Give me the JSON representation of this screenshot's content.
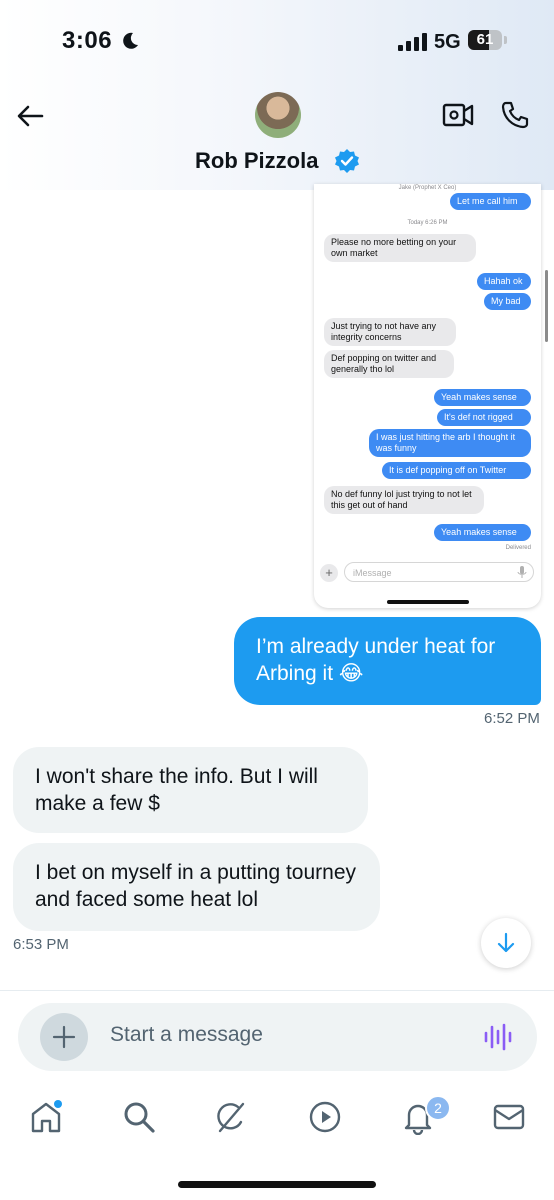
{
  "status_bar": {
    "time": "3:06",
    "network": "5G",
    "battery": "61",
    "battery_level": 0.61
  },
  "header": {
    "contact_name": "Rob Pizzola"
  },
  "embedded_screenshot": {
    "contact_label": "Jake (Prophet X Ceo)",
    "date_label": "Today 6:26 PM",
    "messages": [
      {
        "text": "Let me call him",
        "direction": "out"
      },
      {
        "text": "Please no more betting on your own market",
        "direction": "in"
      },
      {
        "text": "Hahah ok",
        "direction": "out"
      },
      {
        "text": "My bad",
        "direction": "out"
      },
      {
        "text": "Just trying to not have any integrity concerns",
        "direction": "in"
      },
      {
        "text": "Def popping on twitter and generally tho lol",
        "direction": "in"
      },
      {
        "text": "Yeah makes sense",
        "direction": "out"
      },
      {
        "text": "It's def not rigged",
        "direction": "out"
      },
      {
        "text": "I was just hitting the arb I thought it was funny",
        "direction": "out"
      },
      {
        "text": "It is def popping off on Twitter",
        "direction": "out"
      },
      {
        "text": "No def funny lol just trying to not let this get out of hand",
        "direction": "in"
      },
      {
        "text": "Yeah makes sense",
        "direction": "out"
      }
    ],
    "delivered_label": "Delivered",
    "compose_placeholder": "iMessage"
  },
  "conversation": {
    "outgoing": {
      "text": "I’m already under heat for Arbing it 😂",
      "time": "6:52 PM"
    },
    "incoming": [
      {
        "text": "I won't share the info. But I will make a few $"
      },
      {
        "text": "I bet on myself in a putting tourney and faced some heat lol"
      }
    ],
    "incoming_time": "6:53 PM"
  },
  "composer": {
    "placeholder": "Start a message"
  },
  "bottom_nav": {
    "items": [
      "home-icon",
      "search-icon",
      "grok-icon",
      "video-icon",
      "notifications-icon",
      "messages-icon"
    ],
    "notification_count": "2"
  },
  "colors": {
    "accent": "#1d9bf0",
    "imessage_blue": "#3e8bf3",
    "voice_purple": "#8a5cf5"
  }
}
